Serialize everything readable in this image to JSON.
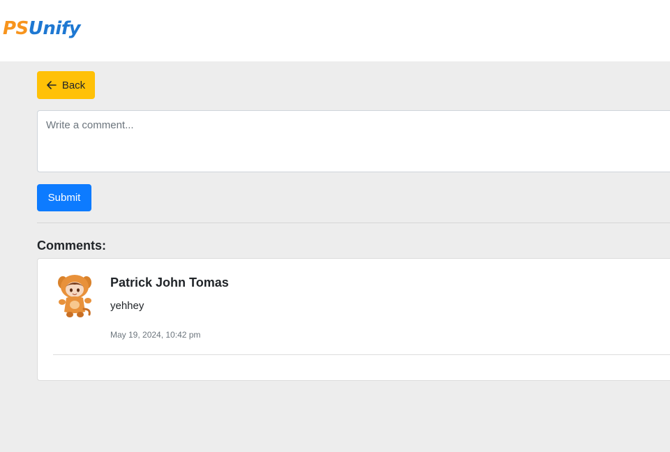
{
  "header": {
    "logo_part1": "PS",
    "logo_part2": "Unify"
  },
  "actions": {
    "back_label": "Back",
    "submit_label": "Submit"
  },
  "comment_form": {
    "placeholder": "Write a comment...",
    "value": ""
  },
  "comments": {
    "heading": "Comments:",
    "items": [
      {
        "author": "Patrick John Tomas",
        "text": "yehhey",
        "timestamp": "May 19, 2024, 10:42 pm"
      }
    ]
  },
  "colors": {
    "back_button": "#ffc107",
    "submit_button": "#0d7bff",
    "logo_orange": "#f7941d",
    "logo_blue": "#1e78d2",
    "page_background": "#ededed"
  },
  "icons": {
    "back": "arrow-left-icon",
    "avatar": "avatar"
  }
}
